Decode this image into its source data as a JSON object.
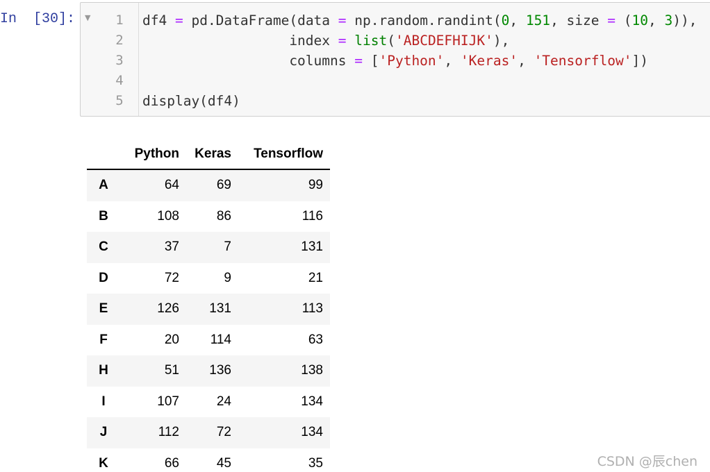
{
  "cell": {
    "prompt": "In  [30]:",
    "collapse_icon": "triangle-down",
    "line_numbers": [
      "1",
      "2",
      "3",
      "4",
      "5"
    ],
    "code_lines": [
      [
        {
          "t": "df4 "
        },
        {
          "t": "=",
          "c": "op"
        },
        {
          "t": " pd.DataFrame(data "
        },
        {
          "t": "=",
          "c": "op"
        },
        {
          "t": " np.random.randint("
        },
        {
          "t": "0",
          "c": "num"
        },
        {
          "t": ", "
        },
        {
          "t": "151",
          "c": "num"
        },
        {
          "t": ", size "
        },
        {
          "t": "=",
          "c": "op"
        },
        {
          "t": " ("
        },
        {
          "t": "10",
          "c": "num"
        },
        {
          "t": ", "
        },
        {
          "t": "3",
          "c": "num"
        },
        {
          "t": ")),"
        }
      ],
      [
        {
          "t": "                  index "
        },
        {
          "t": "=",
          "c": "op"
        },
        {
          "t": " "
        },
        {
          "t": "list",
          "c": "builtin"
        },
        {
          "t": "("
        },
        {
          "t": "'ABCDEFHIJK'",
          "c": "str"
        },
        {
          "t": "),"
        }
      ],
      [
        {
          "t": "                  columns "
        },
        {
          "t": "=",
          "c": "op"
        },
        {
          "t": " ["
        },
        {
          "t": "'Python'",
          "c": "str"
        },
        {
          "t": ", "
        },
        {
          "t": "'Keras'",
          "c": "str"
        },
        {
          "t": ", "
        },
        {
          "t": "'Tensorflow'",
          "c": "str"
        },
        {
          "t": "])"
        }
      ],
      [],
      [
        {
          "t": "display(df4)"
        }
      ]
    ]
  },
  "output_table": {
    "columns": [
      "Python",
      "Keras",
      "Tensorflow"
    ],
    "rows": [
      {
        "index": "A",
        "values": [
          "64",
          "69",
          "99"
        ]
      },
      {
        "index": "B",
        "values": [
          "108",
          "86",
          "116"
        ]
      },
      {
        "index": "C",
        "values": [
          "37",
          "7",
          "131"
        ]
      },
      {
        "index": "D",
        "values": [
          "72",
          "9",
          "21"
        ]
      },
      {
        "index": "E",
        "values": [
          "126",
          "131",
          "113"
        ]
      },
      {
        "index": "F",
        "values": [
          "20",
          "114",
          "63"
        ]
      },
      {
        "index": "H",
        "values": [
          "51",
          "136",
          "138"
        ]
      },
      {
        "index": "I",
        "values": [
          "107",
          "24",
          "134"
        ]
      },
      {
        "index": "J",
        "values": [
          "112",
          "72",
          "134"
        ]
      },
      {
        "index": "K",
        "values": [
          "66",
          "45",
          "35"
        ]
      }
    ]
  },
  "watermark": "CSDN @辰chen",
  "colors": {
    "prompt": "#303f9f",
    "operator": "#aa22ff",
    "number": "#008800",
    "string": "#ba2121",
    "builtin": "#008000",
    "cell_background": "#f7f7f7",
    "striped_row": "#f5f5f5"
  }
}
